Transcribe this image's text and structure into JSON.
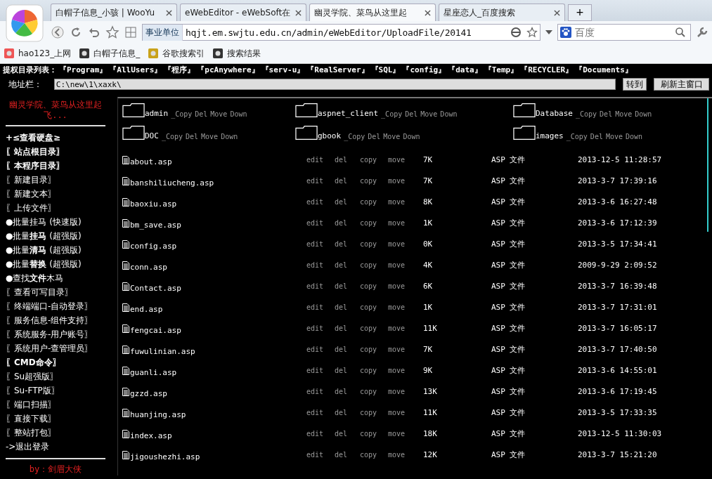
{
  "browser": {
    "tabs": [
      {
        "title": "白帽子信息_小骇 | WooYu",
        "selected": false
      },
      {
        "title": "eWebEditor - eWebSoft在",
        "selected": false
      },
      {
        "title": "幽灵学院、菜鸟从这里起",
        "selected": true
      },
      {
        "title": "星座恋人_百度搜索",
        "selected": false
      }
    ],
    "new_tab": "+",
    "address_badge": "事业单位",
    "url": "hqjt.em.swjtu.edu.cn/admin/eWebEditor/UploadFile/20141",
    "search_placeholder": "百度",
    "bookmarks": [
      "hao123_上网",
      "白帽子信息_",
      "谷歌搜索引",
      "搜索结果"
    ]
  },
  "page": {
    "dir_list_label": "提权目录列表：",
    "dirs": [
      "『Program』",
      "『AllUsers』",
      "『程序』",
      "『pcAnywhere』",
      "『serv-u』",
      "『RealServer』",
      "『SQL』",
      "『config』",
      "『data』",
      "『Temp』",
      "『RECYCLER』",
      "『Documents』"
    ],
    "address_label": "地址栏：",
    "address_value": "C:\\new\\1\\xaxk\\",
    "go_button": "转到",
    "refresh_button": "刷新主窗口",
    "sidebar": {
      "title": "幽灵学院、菜鸟从这里起飞...",
      "items": [
        {
          "text": "**+≤查看硬盘≥**"
        },
        {
          "text": "**〖站点根目录〗**"
        },
        {
          "text": "**〖本程序目录〗**"
        },
        {
          "text": "〖新建目录〗"
        },
        {
          "text": "〖新建文本〗"
        },
        {
          "text": "〖上传文件〗"
        },
        {
          "text": "●批量挂马 (快速版)"
        },
        {
          "text": "●批量**挂马** (超强版)"
        },
        {
          "text": "●批量**清马** (超强版)"
        },
        {
          "text": "●批量**替换** (超强版)"
        },
        {
          "text": "●查找**文件**木马"
        },
        {
          "text": "〖查看可写目录〗"
        },
        {
          "text": "〖终端端口-自动登录〗"
        },
        {
          "text": "〖服务信息-组件支持〗"
        },
        {
          "text": "〖系统服务-用户账号〗"
        },
        {
          "text": "〖系统用户-查管理员〗"
        },
        {
          "text": "**〖CMD命令〗**"
        },
        {
          "text": "〖Su超强版〗"
        },
        {
          "text": "〖Su-FTP版〗"
        },
        {
          "text": "〖端口扫描〗"
        },
        {
          "text": "〖直接下载〗"
        },
        {
          "text": "〖整站打包〗"
        },
        {
          "text": "->退出登录"
        }
      ],
      "footer": "by：剑眉大侠"
    },
    "folders": [
      {
        "name": "admin",
        "actions": [
          "_Copy",
          "Del",
          "Move",
          "Down"
        ]
      },
      {
        "name": "aspnet_client",
        "actions": [
          "_Copy",
          "Del",
          "Move",
          "Down"
        ]
      },
      {
        "name": "Database",
        "actions": [
          "_Copy",
          "Del",
          "Move",
          "Down"
        ]
      },
      {
        "name": "DOC",
        "actions": [
          "_Copy",
          "Del",
          "Move",
          "Down"
        ]
      },
      {
        "name": "gbook",
        "actions": [
          "_Copy",
          "Del",
          "Move",
          "Down"
        ]
      },
      {
        "name": "images",
        "actions": [
          "_Copy",
          "Del",
          "Move",
          "Down"
        ]
      }
    ],
    "files": [
      {
        "name": "about.asp",
        "actions": [
          "edit",
          "del",
          "copy",
          "move"
        ],
        "size": "7K",
        "type": "ASP 文件",
        "date": "2013-12-5 11:28:57"
      },
      {
        "name": "banshiliucheng.asp",
        "actions": [
          "edit",
          "del",
          "copy",
          "move"
        ],
        "size": "7K",
        "type": "ASP 文件",
        "date": "2013-3-7 17:39:16"
      },
      {
        "name": "baoxiu.asp",
        "actions": [
          "edit",
          "del",
          "copy",
          "move"
        ],
        "size": "8K",
        "type": "ASP 文件",
        "date": "2013-3-6 16:27:48"
      },
      {
        "name": "bm_save.asp",
        "actions": [
          "edit",
          "del",
          "copy",
          "move"
        ],
        "size": "1K",
        "type": "ASP 文件",
        "date": "2013-3-6 17:12:39"
      },
      {
        "name": "config.asp",
        "actions": [
          "edit",
          "del",
          "copy",
          "move"
        ],
        "size": "0K",
        "type": "ASP 文件",
        "date": "2013-3-5 17:34:41"
      },
      {
        "name": "conn.asp",
        "actions": [
          "edit",
          "del",
          "copy",
          "move"
        ],
        "size": "4K",
        "type": "ASP 文件",
        "date": "2009-9-29 2:09:52"
      },
      {
        "name": "Contact.asp",
        "actions": [
          "edit",
          "del",
          "copy",
          "move"
        ],
        "size": "6K",
        "type": "ASP 文件",
        "date": "2013-3-7 16:39:48"
      },
      {
        "name": "end.asp",
        "actions": [
          "edit",
          "del",
          "copy",
          "move"
        ],
        "size": "1K",
        "type": "ASP 文件",
        "date": "2013-3-7 17:31:01"
      },
      {
        "name": "fengcai.asp",
        "actions": [
          "edit",
          "del",
          "copy",
          "move"
        ],
        "size": "11K",
        "type": "ASP 文件",
        "date": "2013-3-7 16:05:17"
      },
      {
        "name": "fuwulinian.asp",
        "actions": [
          "edit",
          "del",
          "copy",
          "move"
        ],
        "size": "7K",
        "type": "ASP 文件",
        "date": "2013-3-7 17:40:50"
      },
      {
        "name": "guanli.asp",
        "actions": [
          "edit",
          "del",
          "copy",
          "move"
        ],
        "size": "9K",
        "type": "ASP 文件",
        "date": "2013-3-6 14:55:01"
      },
      {
        "name": "gzzd.asp",
        "actions": [
          "edit",
          "del",
          "copy",
          "move"
        ],
        "size": "13K",
        "type": "ASP 文件",
        "date": "2013-3-6 17:19:45"
      },
      {
        "name": "huanjing.asp",
        "actions": [
          "edit",
          "del",
          "copy",
          "move"
        ],
        "size": "11K",
        "type": "ASP 文件",
        "date": "2013-3-5 17:33:35"
      },
      {
        "name": "index.asp",
        "actions": [
          "edit",
          "del",
          "copy",
          "move"
        ],
        "size": "18K",
        "type": "ASP 文件",
        "date": "2013-12-5 11:30:03"
      },
      {
        "name": "jigoushezhi.asp",
        "actions": [
          "edit",
          "del",
          "copy",
          "move"
        ],
        "size": "12K",
        "type": "ASP 文件",
        "date": "2013-3-7 15:21:20"
      }
    ]
  }
}
